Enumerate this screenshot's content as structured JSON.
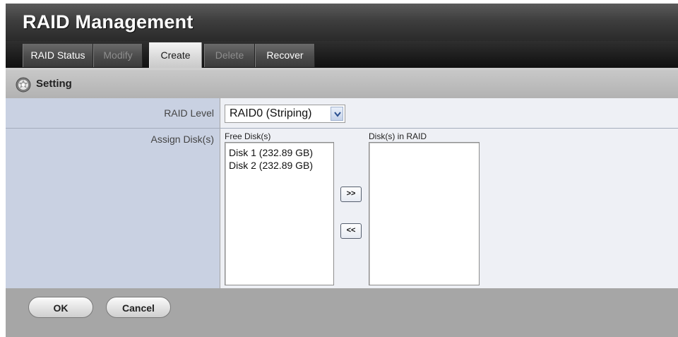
{
  "app": {
    "title": "RAID Management"
  },
  "tabs": [
    {
      "label": "RAID Status",
      "state": "normal"
    },
    {
      "label": "Modify",
      "state": "disabled"
    },
    {
      "label": "Create",
      "state": "active"
    },
    {
      "label": "Delete",
      "state": "disabled"
    },
    {
      "label": "Recover",
      "state": "normal"
    }
  ],
  "section": {
    "title": "Setting",
    "icon": "gear-icon"
  },
  "form": {
    "raid_level": {
      "label": "RAID Level",
      "selected": "RAID0 (Striping)"
    },
    "assign": {
      "label": "Assign Disk(s)",
      "free_caption": "Free Disk(s)",
      "free_disks": [
        "Disk 1 (232.89 GB)",
        "Disk 2 (232.89 GB)"
      ],
      "raid_caption": "Disk(s) in RAID",
      "raid_disks": [],
      "add_label": ">>",
      "remove_label": "<<"
    }
  },
  "footer": {
    "ok_label": "OK",
    "cancel_label": "Cancel"
  }
}
